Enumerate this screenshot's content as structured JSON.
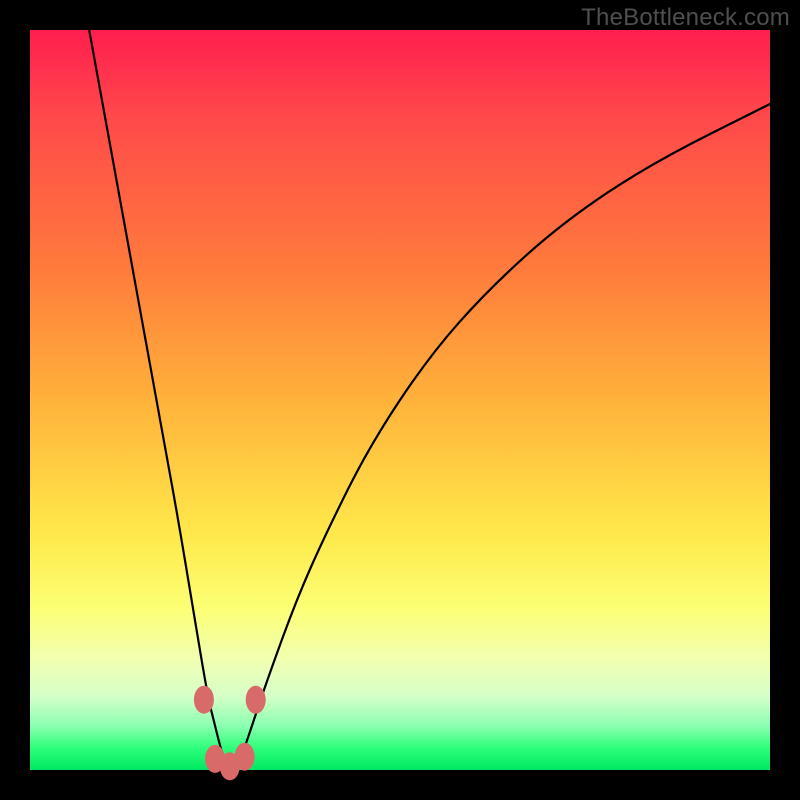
{
  "watermark": "TheBottleneck.com",
  "colors": {
    "page_bg": "#000000",
    "gradient_top": "#ff1e4f",
    "gradient_bottom": "#00e860",
    "curve": "#000000",
    "marker": "#d86a6a"
  },
  "chart_data": {
    "type": "line",
    "title": "",
    "xlabel": "",
    "ylabel": "",
    "xlim": [
      0,
      100
    ],
    "ylim": [
      0,
      100
    ],
    "grid": false,
    "legend": false,
    "note": "V-shaped bottleneck curve on a red→green vertical gradient. x and y are percentages of the plot area (0–100). y≈0 near the cusp at x≈27; y rises steeply on both sides.",
    "series": [
      {
        "name": "bottleneck-curve",
        "x": [
          8,
          10,
          12,
          14,
          16,
          18,
          20,
          22,
          24,
          25,
          26,
          27,
          28,
          29,
          30,
          32,
          36,
          40,
          46,
          54,
          62,
          72,
          84,
          100
        ],
        "y": [
          100,
          89,
          78,
          67,
          56,
          45,
          34,
          22,
          10,
          6,
          2,
          0,
          1,
          3,
          6,
          12,
          23,
          32,
          44,
          56,
          65,
          74,
          82,
          90
        ]
      }
    ],
    "markers": {
      "name": "cusp-dots",
      "note": "Rounded salmon dots clustered at the bottom of the V.",
      "points": [
        {
          "x": 23.5,
          "y": 9.5
        },
        {
          "x": 25.0,
          "y": 1.5
        },
        {
          "x": 27.0,
          "y": 0.5
        },
        {
          "x": 29.0,
          "y": 1.8
        },
        {
          "x": 30.5,
          "y": 9.5
        }
      ]
    }
  }
}
